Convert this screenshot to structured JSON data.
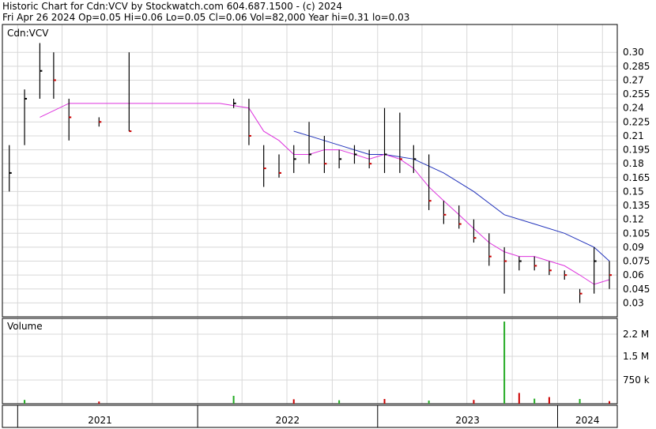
{
  "header": {
    "line1": "Historic Chart for Cdn:VCV by Stockwatch.com 604.687.1500 - (c) 2024",
    "line2": "Fri Apr 26 2024   Op=0.05  Hi=0.06  Lo=0.05  Cl=0.06  Vol=82,000  Year hi=0.31  lo=0.03"
  },
  "chart_data": [
    {
      "type": "line",
      "subtype": "ohlc-price",
      "title": "Cdn:VCV",
      "ylim": [
        0.015,
        0.33
      ],
      "y_ticks": [
        "0.30",
        "0.285",
        "0.27",
        "0.255",
        "0.24",
        "0.225",
        "0.21",
        "0.195",
        "0.18",
        "0.165",
        "0.15",
        "0.135",
        "0.12",
        "0.105",
        "0.09",
        "0.075",
        "0.06",
        "0.045",
        "0.03"
      ],
      "x_ticks": [
        "2021",
        "2022",
        "2023",
        "2024"
      ],
      "grid": true,
      "colors": {
        "up": "#000000",
        "down": "#cc0000",
        "ma_short": "#dd33dd",
        "ma_long": "#2233bb",
        "grid": "#d8d8d8"
      },
      "series": [
        {
          "kind": "moving-average-short",
          "x": [
            "2021-02",
            "2021-04",
            "2021-07",
            "2021-11",
            "2022-02",
            "2022-04",
            "2022-05",
            "2022-06",
            "2022-07",
            "2022-08",
            "2022-09",
            "2022-10",
            "2022-11",
            "2022-12",
            "2023-01",
            "2023-02",
            "2023-03",
            "2023-04",
            "2023-05",
            "2023-06",
            "2023-07",
            "2023-08",
            "2023-09",
            "2023-10",
            "2023-11",
            "2023-12",
            "2024-01",
            "2024-02",
            "2024-03",
            "2024-04"
          ],
          "values": [
            0.23,
            0.245,
            0.245,
            0.245,
            0.245,
            0.24,
            0.215,
            0.205,
            0.19,
            0.19,
            0.195,
            0.195,
            0.19,
            0.185,
            0.19,
            0.185,
            0.175,
            0.155,
            0.14,
            0.125,
            0.11,
            0.095,
            0.085,
            0.08,
            0.08,
            0.075,
            0.07,
            0.06,
            0.05,
            0.055
          ]
        },
        {
          "kind": "moving-average-long",
          "x": [
            "2022-07",
            "2022-08",
            "2022-10",
            "2022-12",
            "2023-01",
            "2023-03",
            "2023-05",
            "2023-07",
            "2023-09",
            "2023-11",
            "2024-01",
            "2024-03",
            "2024-04"
          ],
          "values": [
            0.215,
            0.21,
            0.2,
            0.19,
            0.19,
            0.185,
            0.17,
            0.15,
            0.125,
            0.115,
            0.105,
            0.09,
            0.075
          ]
        },
        {
          "kind": "price-bars",
          "bars": [
            {
              "x": "2020-12",
              "high": 0.2,
              "low": 0.15,
              "close": 0.17
            },
            {
              "x": "2021-01",
              "high": 0.26,
              "low": 0.2,
              "close": 0.25
            },
            {
              "x": "2021-02",
              "high": 0.31,
              "low": 0.25,
              "close": 0.28
            },
            {
              "x": "2021-03",
              "high": 0.3,
              "low": 0.25,
              "close": 0.27
            },
            {
              "x": "2021-04",
              "high": 0.25,
              "low": 0.205,
              "close": 0.23
            },
            {
              "x": "2021-06",
              "high": 0.23,
              "low": 0.22,
              "close": 0.225
            },
            {
              "x": "2021-08",
              "high": 0.3,
              "low": 0.215,
              "close": 0.215
            },
            {
              "x": "2022-03",
              "high": 0.25,
              "low": 0.24,
              "close": 0.245
            },
            {
              "x": "2022-04",
              "high": 0.25,
              "low": 0.2,
              "close": 0.21
            },
            {
              "x": "2022-05",
              "high": 0.2,
              "low": 0.155,
              "close": 0.175
            },
            {
              "x": "2022-06",
              "high": 0.19,
              "low": 0.165,
              "close": 0.17
            },
            {
              "x": "2022-07",
              "high": 0.2,
              "low": 0.17,
              "close": 0.185
            },
            {
              "x": "2022-08",
              "high": 0.225,
              "low": 0.18,
              "close": 0.19
            },
            {
              "x": "2022-09",
              "high": 0.21,
              "low": 0.17,
              "close": 0.18
            },
            {
              "x": "2022-10",
              "high": 0.195,
              "low": 0.175,
              "close": 0.185
            },
            {
              "x": "2022-11",
              "high": 0.2,
              "low": 0.18,
              "close": 0.19
            },
            {
              "x": "2022-12",
              "high": 0.195,
              "low": 0.175,
              "close": 0.18
            },
            {
              "x": "2023-01",
              "high": 0.24,
              "low": 0.17,
              "close": 0.19
            },
            {
              "x": "2023-02",
              "high": 0.235,
              "low": 0.17,
              "close": 0.185
            },
            {
              "x": "2023-03",
              "high": 0.2,
              "low": 0.17,
              "close": 0.185
            },
            {
              "x": "2023-04",
              "high": 0.19,
              "low": 0.13,
              "close": 0.14
            },
            {
              "x": "2023-05",
              "high": 0.14,
              "low": 0.115,
              "close": 0.125
            },
            {
              "x": "2023-06",
              "high": 0.135,
              "low": 0.11,
              "close": 0.115
            },
            {
              "x": "2023-07",
              "high": 0.12,
              "low": 0.095,
              "close": 0.1
            },
            {
              "x": "2023-08",
              "high": 0.105,
              "low": 0.07,
              "close": 0.08
            },
            {
              "x": "2023-09",
              "high": 0.09,
              "low": 0.04,
              "close": 0.075
            },
            {
              "x": "2023-10",
              "high": 0.08,
              "low": 0.065,
              "close": 0.075
            },
            {
              "x": "2023-11",
              "high": 0.08,
              "low": 0.065,
              "close": 0.07
            },
            {
              "x": "2023-12",
              "high": 0.075,
              "low": 0.06,
              "close": 0.065
            },
            {
              "x": "2024-01",
              "high": 0.065,
              "low": 0.055,
              "close": 0.06
            },
            {
              "x": "2024-02",
              "high": 0.045,
              "low": 0.03,
              "close": 0.04
            },
            {
              "x": "2024-03",
              "high": 0.09,
              "low": 0.04,
              "close": 0.075
            },
            {
              "x": "2024-04",
              "high": 0.075,
              "low": 0.045,
              "close": 0.06
            }
          ]
        }
      ]
    },
    {
      "type": "bar",
      "subtype": "volume",
      "title": "Volume",
      "y_ticks": [
        "2.2 M",
        "1.5 M",
        "750 k"
      ],
      "y_tick_values": [
        2200000,
        1500000,
        750000
      ],
      "ylim": [
        0,
        2600000
      ],
      "x": [
        "2021-01",
        "2021-06",
        "2022-03",
        "2022-07",
        "2022-10",
        "2023-01",
        "2023-04",
        "2023-07",
        "2023-09",
        "2023-10",
        "2023-11",
        "2023-12",
        "2024-02",
        "2024-04"
      ],
      "values": [
        120000,
        70000,
        250000,
        140000,
        110000,
        150000,
        100000,
        120000,
        2600000,
        340000,
        160000,
        210000,
        150000,
        82000
      ]
    }
  ]
}
